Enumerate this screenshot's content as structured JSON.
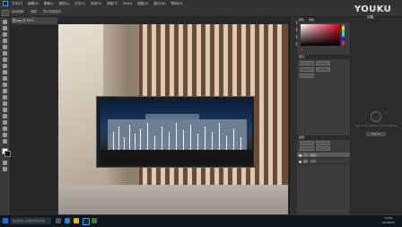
{
  "menubar": {
    "items": [
      "文件(F)",
      "编辑(E)",
      "图像(I)",
      "图层(L)",
      "文字(Y)",
      "选择(S)",
      "滤镜(T)",
      "3D(D)",
      "视图(V)",
      "窗口(W)",
      "帮助(H)"
    ]
  },
  "optionsbar": {
    "items": [
      "自动选择:",
      "图层",
      "显示变换控件"
    ]
  },
  "document": {
    "tab_label": "图.jpg @ 50%"
  },
  "panels": {
    "tabs": [
      "颜色",
      "色板"
    ],
    "properties_label": "属性",
    "adjust_label": "调整",
    "layers_tab": "图层",
    "layers": [
      {
        "name": "图层 1"
      },
      {
        "name": "背景"
      }
    ]
  },
  "cc": {
    "text": "Sign in to Creative Cloud Libraries",
    "button": "Sign In"
  },
  "watermark": {
    "brand": "YOUKU",
    "sub": "优酷"
  },
  "taskbar": {
    "search_placeholder": "在这里输入你要搜索的内容",
    "time": "10:44",
    "date": "2018/1/5"
  },
  "colors": {
    "accent": "#e2001b",
    "ps_blue": "#3fa3f0"
  }
}
